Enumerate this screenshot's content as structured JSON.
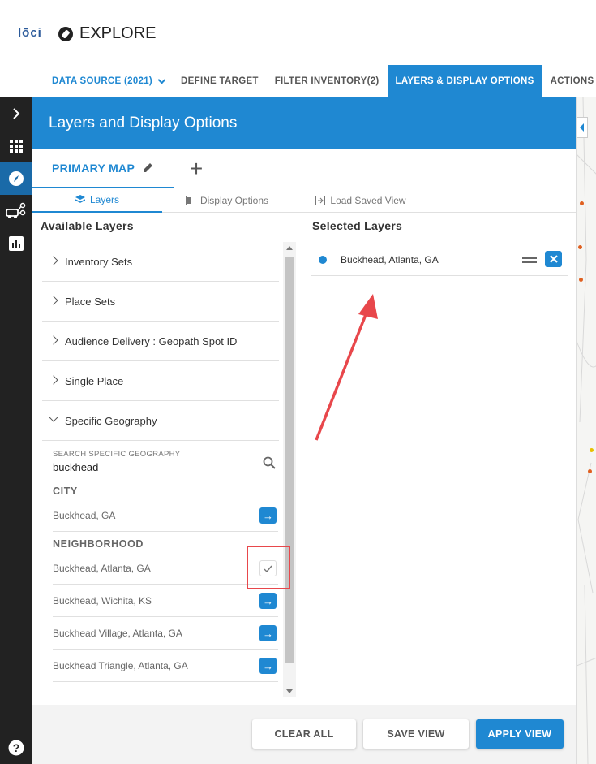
{
  "app": {
    "logo": "lōci",
    "title": "EXPLORE"
  },
  "nav": {
    "data_source": "DATA SOURCE (2021)",
    "tabs": [
      "DEFINE TARGET",
      "FILTER INVENTORY(2)",
      "LAYERS & DISPLAY OPTIONS",
      "ACTIONS"
    ],
    "active_tab": "LAYERS & DISPLAY OPTIONS"
  },
  "panel": {
    "title": "Layers and Display Options",
    "map_tab": "PRIMARY MAP",
    "add_symbol": "+",
    "subtabs": [
      "Layers",
      "Display Options",
      "Load Saved View"
    ],
    "active_subtab": "Layers"
  },
  "available": {
    "header": "Available Layers",
    "sections": [
      "Inventory Sets",
      "Place Sets",
      "Audience Delivery : Geopath Spot ID",
      "Single Place",
      "Specific Geography"
    ],
    "search": {
      "placeholder": "SEARCH SPECIFIC GEOGRAPHY",
      "value": "buckhead"
    },
    "city_label": "CITY",
    "city_results": [
      "Buckhead, GA"
    ],
    "neighborhood_label": "NEIGHBORHOOD",
    "neighborhood_results": [
      {
        "name": "Buckhead, Atlanta, GA",
        "selected": true
      },
      {
        "name": "Buckhead, Wichita, KS",
        "selected": false
      },
      {
        "name": "Buckhead Village, Atlanta, GA",
        "selected": false
      },
      {
        "name": "Buckhead Triangle, Atlanta, GA",
        "selected": false
      }
    ]
  },
  "selected": {
    "header": "Selected Layers",
    "items": [
      {
        "name": "Buckhead, Atlanta, GA",
        "color": "#1f88d2"
      }
    ]
  },
  "footer": {
    "clear": "CLEAR ALL",
    "save": "SAVE VIEW",
    "apply": "APPLY VIEW"
  },
  "colors": {
    "accent": "#1f88d2",
    "rail": "#222222",
    "annotation": "#e8474b"
  }
}
